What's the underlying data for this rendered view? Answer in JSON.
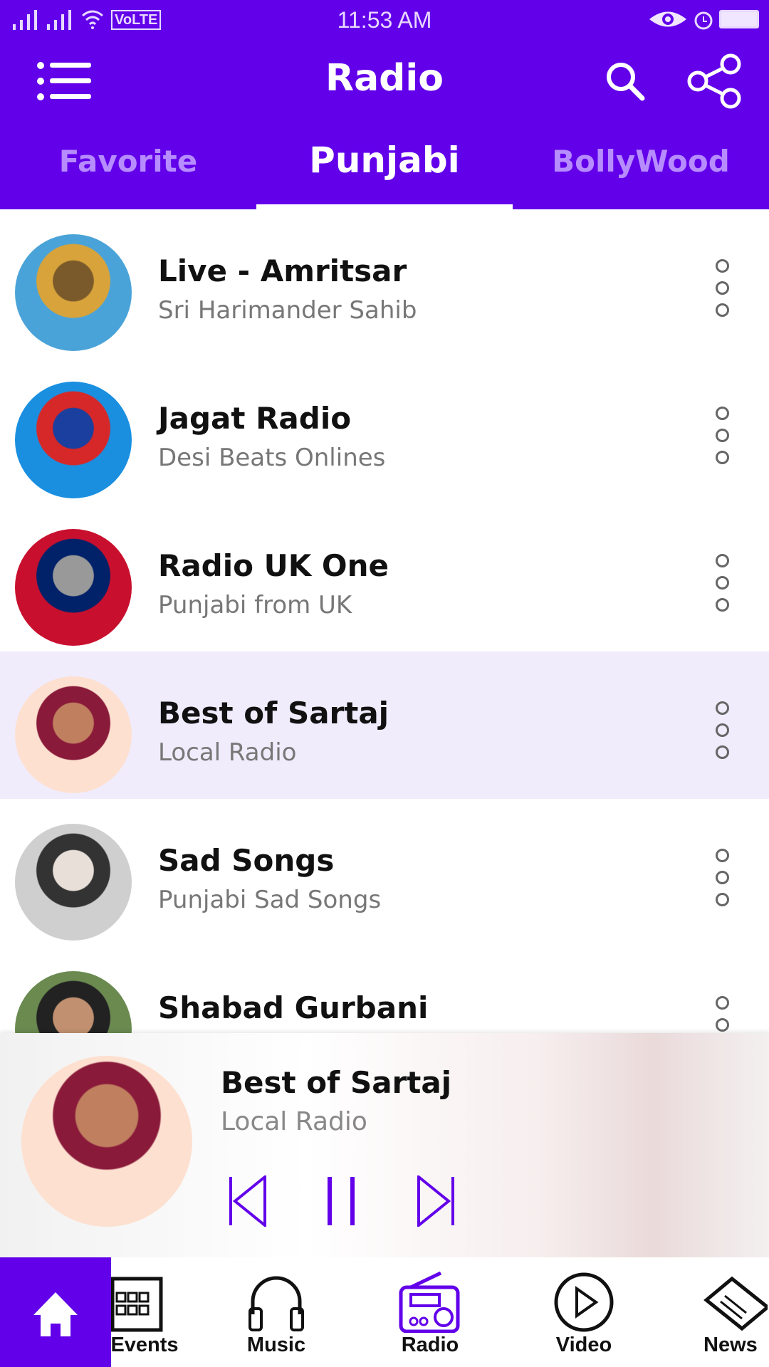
{
  "status_bar": {
    "time": "11:53 AM",
    "network": "VoLTE"
  },
  "header": {
    "title": "Radio",
    "menu_icon": "hamburger-icon",
    "search_icon": "search-icon",
    "share_icon": "share-icon"
  },
  "tabs": [
    {
      "label": "Favorite"
    },
    {
      "label": "Punjabi",
      "active": true
    },
    {
      "label": "BollyWood"
    }
  ],
  "stations": [
    {
      "title": "Live - Amritsar",
      "subtitle": "Sri Harimander Sahib",
      "colors": [
        "#4aa3d8",
        "#d8a33a",
        "#7a5a2a"
      ]
    },
    {
      "title": "Jagat Radio",
      "subtitle": "Desi Beats Onlines",
      "colors": [
        "#1a8fe0",
        "#d62828",
        "#1a3f9e"
      ]
    },
    {
      "title": "Radio UK One",
      "subtitle": "Punjabi from  UK",
      "colors": [
        "#c8102e",
        "#012169",
        "#999999"
      ]
    },
    {
      "title": "Best of Sartaj",
      "subtitle": "Local Radio",
      "colors": [
        "#fde0d0",
        "#8a1a3a",
        "#c08060"
      ],
      "selected": true
    },
    {
      "title": "Sad Songs",
      "subtitle": "Punjabi Sad Songs",
      "colors": [
        "#cfcfcf",
        "#333333",
        "#e8e0d8"
      ]
    },
    {
      "title": "Shabad Gurbani",
      "subtitle": "",
      "colors": [
        "#6a8a50",
        "#222222",
        "#c09070"
      ]
    }
  ],
  "player": {
    "title": "Best of Sartaj",
    "subtitle": "Local Radio",
    "state": "playing"
  },
  "bottom_nav": [
    {
      "label": "",
      "icon": "home-icon",
      "active": true
    },
    {
      "label": "Events",
      "icon": "calendar-icon"
    },
    {
      "label": "Music",
      "icon": "headphones-icon"
    },
    {
      "label": "Radio",
      "icon": "radio-icon",
      "highlight": true
    },
    {
      "label": "Video",
      "icon": "play-circle-icon"
    },
    {
      "label": "News",
      "icon": "newspaper-icon"
    }
  ],
  "colors": {
    "primary": "#6200EA",
    "tab_inactive": "#b68cff",
    "selected_row": "#f0ecfc"
  }
}
